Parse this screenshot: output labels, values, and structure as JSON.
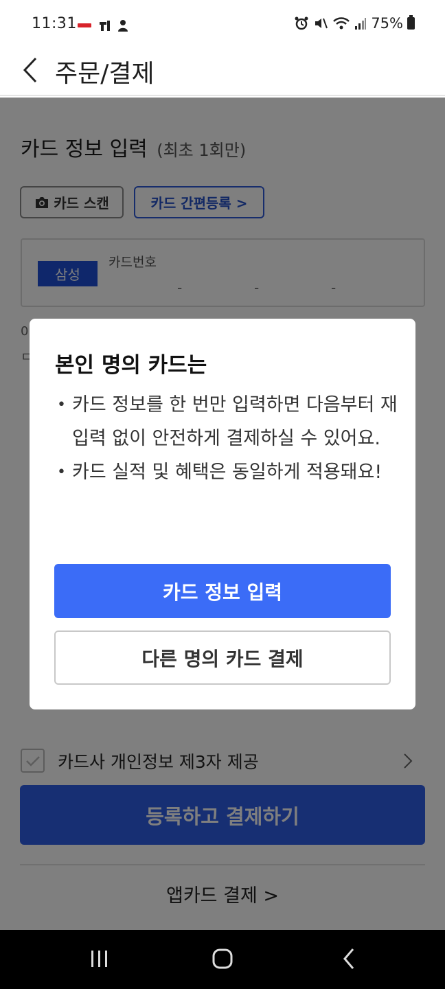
{
  "status_bar": {
    "time": "11:31",
    "battery": "75%"
  },
  "header": {
    "title": "주문/결제"
  },
  "card_section": {
    "title": "카드 정보 입력",
    "subtitle": "(최초 1회만)",
    "scan_button": "카드 스캔",
    "easy_register_button": "카드 간편등록 >",
    "card_brand": "삼성",
    "card_number_label": "카드번호",
    "dash": "-",
    "hint_line1_initial": "0",
    "hint_line2_initial": "ㄷ"
  },
  "agree": {
    "label": "카드사 개인정보 제3자 제공"
  },
  "register_button": "등록하고 결제하기",
  "appcard_link": "앱카드 결제 >",
  "modal": {
    "title": "본인 명의 카드는",
    "bullets": [
      "카드 정보를 한 번만 입력하면 다음부터 재입력 없이 안전하게 결제하실 수 있어요.",
      "카드 실적 및 혜택은 동일하게 적용돼요!"
    ],
    "primary_button": "카드 정보 입력",
    "secondary_button": "다른 명의 카드 결제"
  },
  "colors": {
    "primary": "#3b6cf7",
    "brand_badge": "#1e4fd6"
  }
}
